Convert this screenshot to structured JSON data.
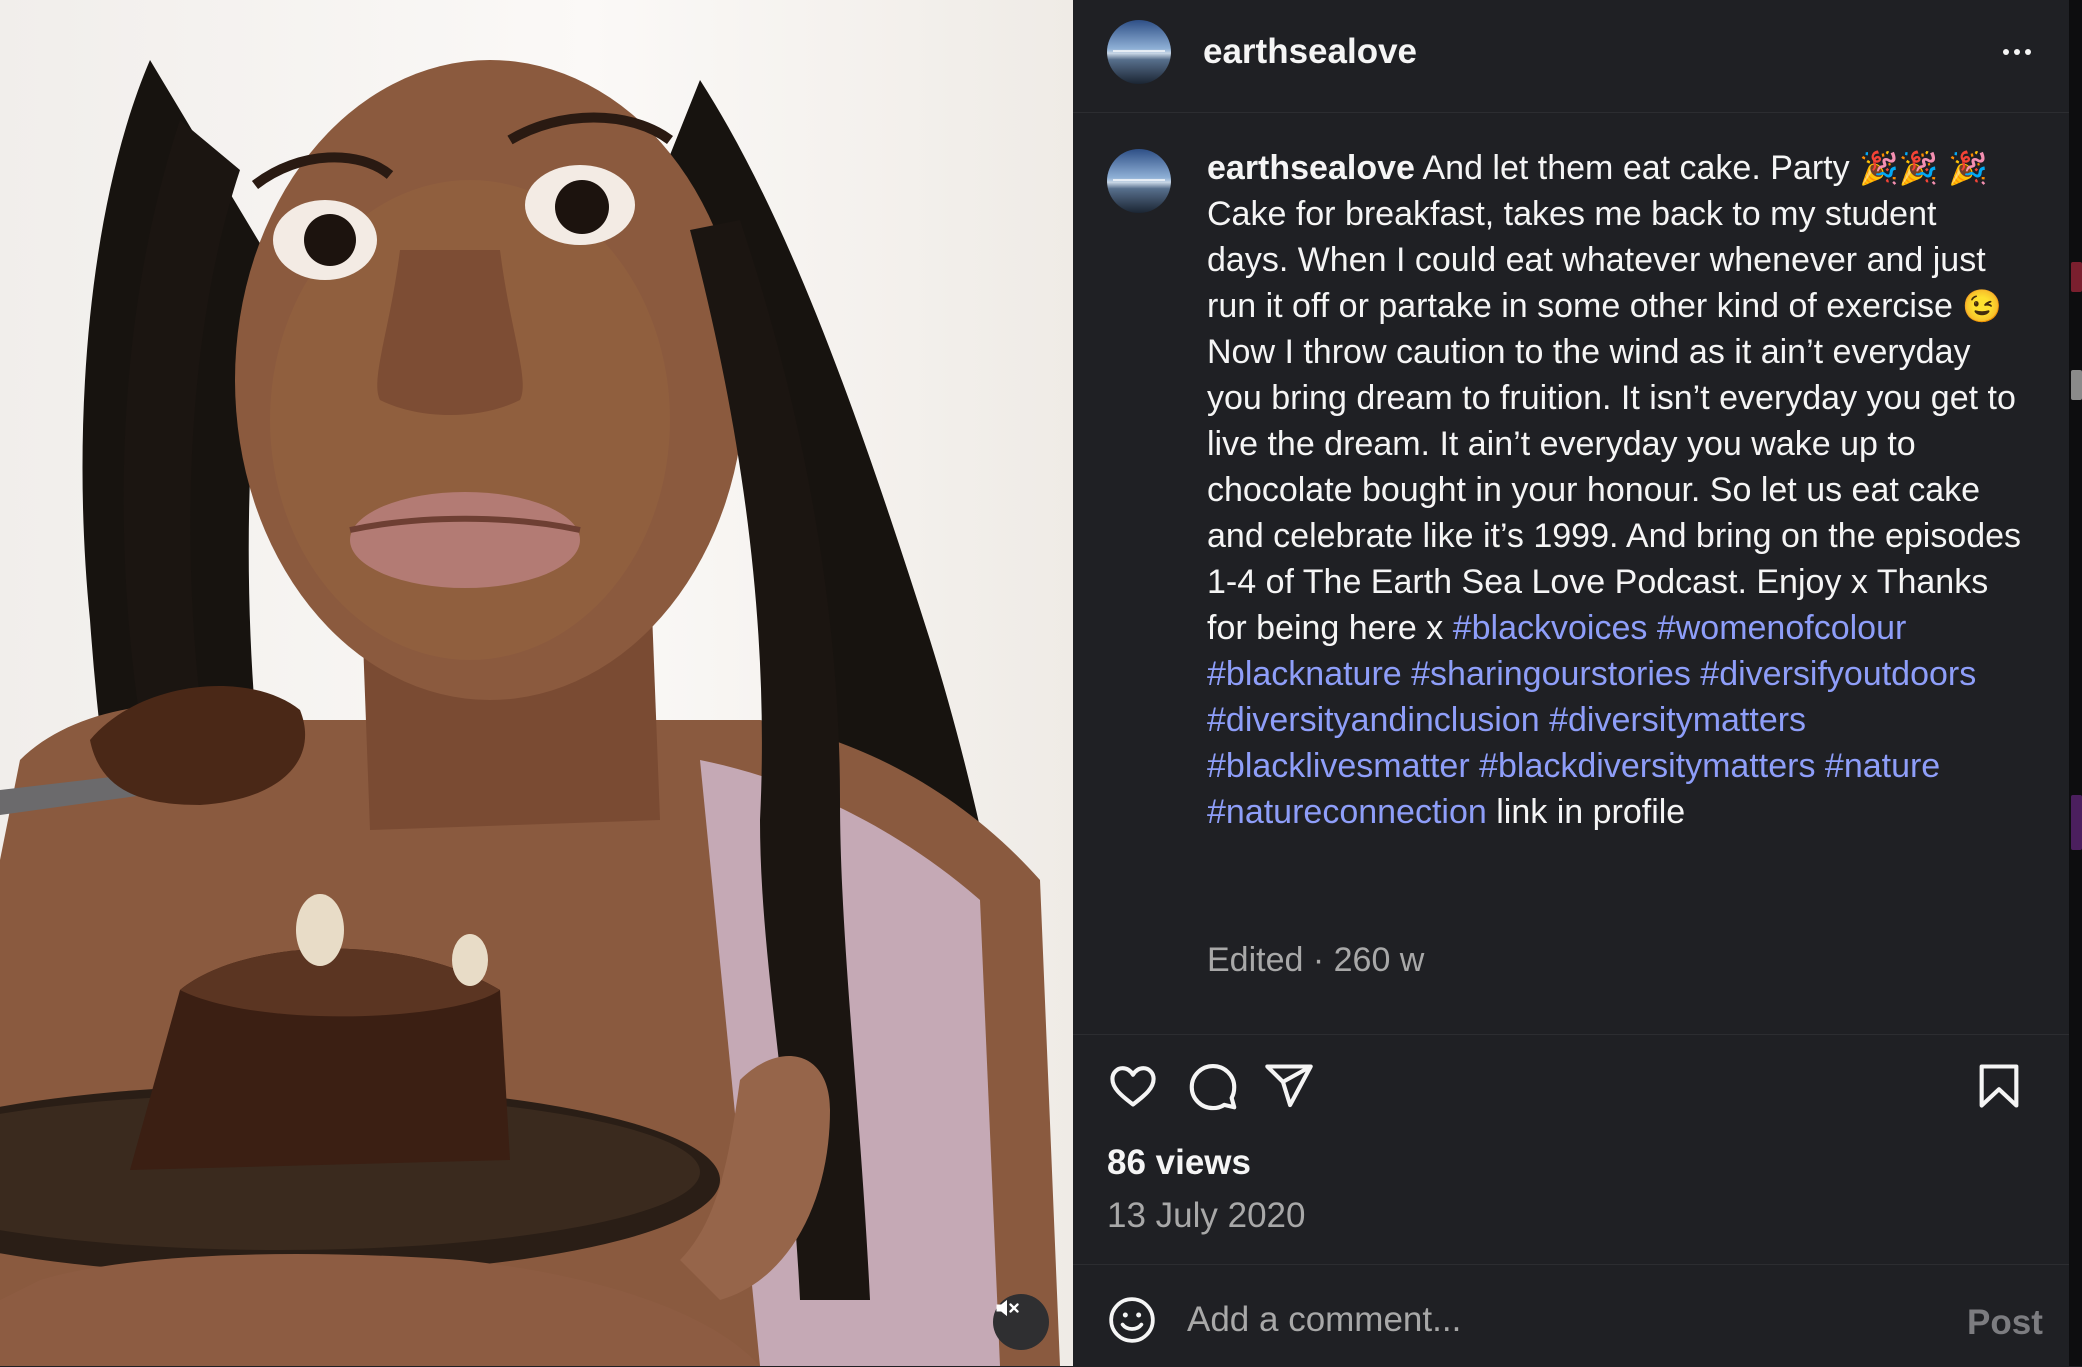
{
  "post": {
    "username": "earthsealove",
    "more_icon": "more-horizontal-icon",
    "caption": {
      "username": "earthsealove",
      "line1": "And let them eat cake. Party",
      "party_emoji": "🎉",
      "body1": "Cake for breakfast, takes me back to my student days. When I could eat whatever whenever and just run it off or partake in some other kind of exercise",
      "wink_emoji": "😉",
      "body2": "Now I throw caution to the wind as it ain’t everyday you bring dream to fruition. It isn’t everyday you get to live the dream. It ain’t everyday you wake up to chocolate bought in your honour. So let us eat cake and celebrate like it’s 1999. And bring on the episodes 1-4 of The Earth Sea Love Podcast. Enjoy x Thanks for being here x",
      "hashtags": [
        "#blackvoices",
        "#womenofcolour",
        "#blacknature",
        "#sharingourstories",
        "#diversifyoutdoors",
        "#diversityandinclusion",
        "#diversitymatters",
        "#blacklivesmatter",
        "#blackdiversitymatters",
        "#nature",
        "#natureconnection"
      ],
      "tail": "link in profile"
    },
    "meta": "Edited · 260 w",
    "views": "86 views",
    "date": "13 July 2020",
    "actions": [
      "heart-icon",
      "comment-icon",
      "share-icon",
      "bookmark-icon"
    ],
    "comment": {
      "placeholder": "Add a comment...",
      "post_label": "Post"
    },
    "media": {
      "mute_icon": "speaker-muted-icon"
    }
  },
  "colors": {
    "panel_bg": "#1f2024",
    "hashtag": "#8e9ef9",
    "secondary_text": "#a8a8a8"
  }
}
